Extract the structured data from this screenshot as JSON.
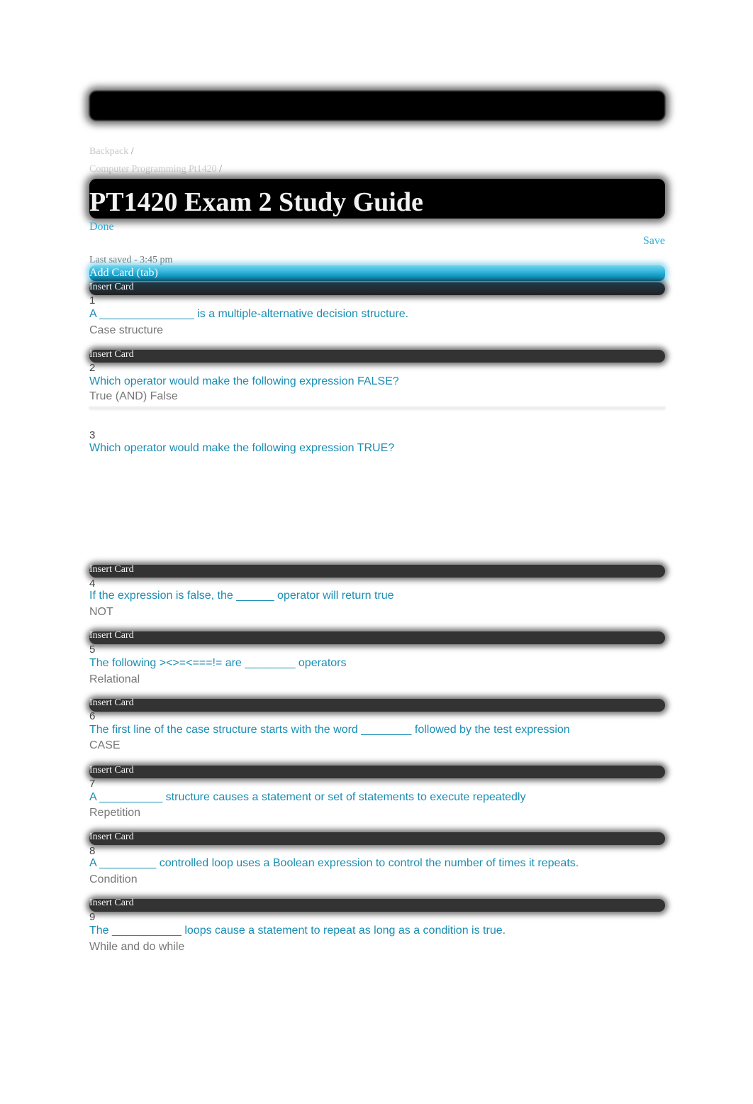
{
  "breadcrumb": [
    {
      "label": "Backpack",
      "sep": "/"
    },
    {
      "label": "Computer Programming Pt1420",
      "sep": "/"
    }
  ],
  "page_title": "PT1420 Exam 2 Study Guide",
  "actions": {
    "done_label": "Done",
    "save_label": "Save",
    "last_saved": "Last saved - 3:45 pm",
    "add_card_label": "Add Card (tab)",
    "insert_card_label": "Insert Card"
  },
  "colors": {
    "accent": "#29aed8",
    "question_text": "#1a8db3",
    "answer_text": "#777777"
  },
  "cards": [
    {
      "number": "1",
      "question": "A _______________ is a multiple-alternative decision structure.",
      "answer": "Case structure"
    },
    {
      "number": "2",
      "question": "Which operator would make the following expression FALSE?",
      "answer": "True (AND) False"
    },
    {
      "number": "3",
      "question": "Which operator would make the following expression TRUE?",
      "answer": ""
    },
    {
      "number": "4",
      "question": "If the expression is false, the ______ operator will return true",
      "answer": "NOT"
    },
    {
      "number": "5",
      "question": "The following ><>=<===!= are ________ operators",
      "answer": "Relational"
    },
    {
      "number": "6",
      "question": "The first line of the case structure starts with the word ________ followed by the test expression",
      "answer": "CASE"
    },
    {
      "number": "7",
      "question": "A __________ structure causes a statement or set of statements to execute repeatedly",
      "answer": "Repetition"
    },
    {
      "number": "8",
      "question": "A _________ controlled loop uses a Boolean expression to control the number of times it repeats.",
      "answer": "Condition"
    },
    {
      "number": "9",
      "question": "The ___________ loops cause a statement to repeat as long as a condition is true.",
      "answer": "While and do while"
    }
  ]
}
